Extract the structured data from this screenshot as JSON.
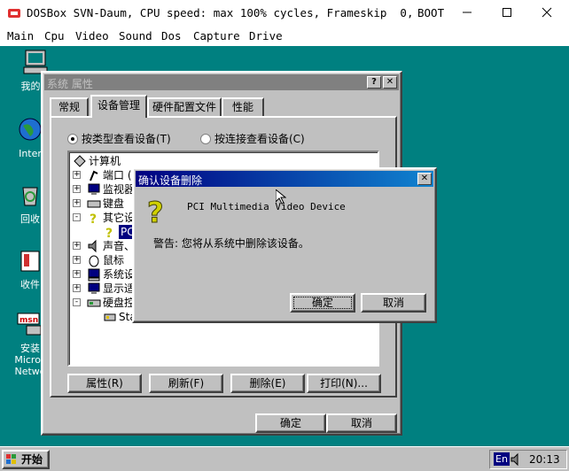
{
  "host": {
    "title": "DOSBox SVN-Daum, CPU speed: max 100% cycles, Frameskip  0,",
    "program": "BOOT",
    "menu": [
      "Main",
      "Cpu",
      "Video",
      "Sound",
      "Dos",
      "Capture",
      "Drive"
    ]
  },
  "desktop": {
    "icons": [
      {
        "label": "我的电"
      },
      {
        "label": "Inter"
      },
      {
        "label": "回收"
      },
      {
        "label": "收件"
      },
      {
        "label_lines": [
          "安装",
          "Micros",
          "Netwo"
        ]
      }
    ]
  },
  "system_properties": {
    "title": "系统 属性",
    "tabs": [
      "常规",
      "设备管理",
      "硬件配置文件",
      "性能"
    ],
    "view_by_type": "按类型查看设备(T)",
    "view_by_connection": "按连接查看设备(C)",
    "tree": [
      {
        "label": "计算机",
        "level": 0,
        "expander": ""
      },
      {
        "label": "端口 (C",
        "level": 1,
        "expander": "+"
      },
      {
        "label": "监视器",
        "level": 1,
        "expander": "+"
      },
      {
        "label": "键盘",
        "level": 1,
        "expander": "+"
      },
      {
        "label": "其它设",
        "level": 1,
        "expander": "-"
      },
      {
        "label": "PCI",
        "level": 2,
        "expander": ""
      },
      {
        "label": "声音、",
        "level": 1,
        "expander": "+"
      },
      {
        "label": "鼠标",
        "level": 1,
        "expander": "+"
      },
      {
        "label": "系统设",
        "level": 1,
        "expander": "+"
      },
      {
        "label": "显示适",
        "level": 1,
        "expander": "+"
      },
      {
        "label": "硬盘控",
        "level": 1,
        "expander": "-"
      },
      {
        "label": "Sta",
        "level": 2,
        "expander": ""
      }
    ],
    "buttons": {
      "properties": "属性(R)",
      "refresh": "刷新(F)",
      "remove": "删除(E)",
      "print": "打印(N)..."
    },
    "ok": "确定",
    "cancel": "取消"
  },
  "confirm_dialog": {
    "title": "确认设备删除",
    "device": "PCI Multimedia Video Device",
    "warning": "警告: 您将从系统中删除该设备。",
    "ok": "确定",
    "cancel": "取消"
  },
  "taskbar": {
    "start": "开始",
    "ime": "En",
    "clock": "20:13"
  }
}
